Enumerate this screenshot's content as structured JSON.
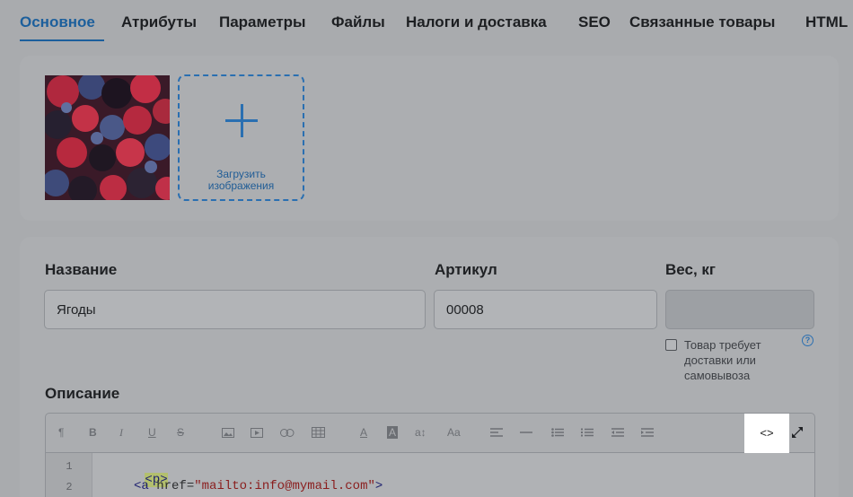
{
  "tabs": [
    {
      "label": "Основное"
    },
    {
      "label": "Атрибуты"
    },
    {
      "label": "Параметры"
    },
    {
      "label": "Файлы"
    },
    {
      "label": "Налоги и доставка"
    },
    {
      "label": "SEO"
    },
    {
      "label": "Связанные товары"
    },
    {
      "label": "HTML"
    }
  ],
  "images": {
    "thumbnail_icon": "berries-photo",
    "upload_label_line1": "Загрузить",
    "upload_label_line2": "изображения"
  },
  "form": {
    "name_label": "Название",
    "name_value": "Ягоды",
    "sku_label": "Артикул",
    "sku_value": "00008",
    "weight_label": "Вес, кг",
    "weight_value": "",
    "delivery_checkbox_label": "Товар требует доставки или самовывоза",
    "delivery_checked": false,
    "help_icon": "question-circle-icon",
    "help_glyph": "?",
    "description_label": "Описание"
  },
  "editor": {
    "toolbar_icons": [
      "paragraph-icon",
      "bold-icon",
      "italic-icon",
      "underline-icon",
      "strikethrough-icon",
      "image-icon",
      "video-icon",
      "link-icon",
      "table-icon",
      "font-color-icon",
      "background-color-icon",
      "font-size-icon",
      "font-family-icon",
      "align-left-icon",
      "horizontal-rule-icon",
      "unordered-list-icon",
      "ordered-list-icon",
      "outdent-icon",
      "indent-icon",
      "code-view-icon",
      "fullscreen-icon"
    ],
    "toolbar_glyphs": {
      "paragraph": "¶",
      "bold": "B",
      "italic": "I",
      "underline": "U",
      "strike": "S",
      "font_color": "A",
      "background_color": "A",
      "font_size": "a↕",
      "font_family": "Aa",
      "code_view": "<>"
    },
    "code_lines": [
      {
        "number": "1",
        "open": "<p>"
      },
      {
        "number": "2",
        "tag_open": "<a",
        "attr": " href",
        "eq": "=",
        "value": "\"mailto:info@mymail.com\"",
        "tag_close": ">"
      }
    ]
  },
  "colors": {
    "accent": "#1c5f9c",
    "text": "#1f2124",
    "highlight": "#b3bf6e"
  }
}
